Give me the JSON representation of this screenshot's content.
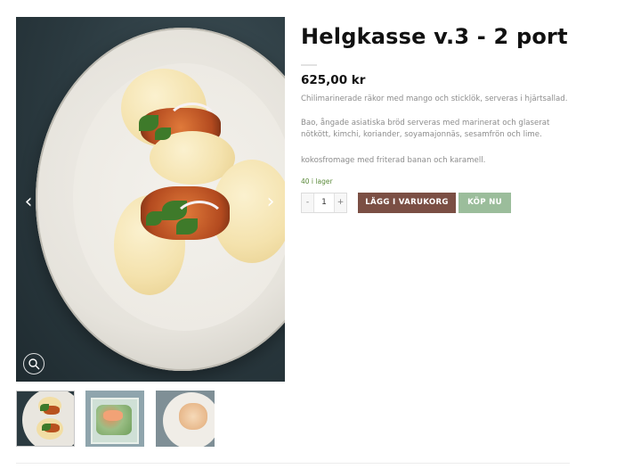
{
  "product": {
    "title": "Helgkasse v.3 - 2 port",
    "price": "625,00 kr",
    "description": [
      "Chilimarinerade räkor med mango och sticklök, serveras i hjärtsallad.",
      "Bao, ångade asiatiska bröd serveras med marinerat och glaserat nötkött, kimchi, koriander, soyamajonnäs, sesamfrön och lime.",
      "kokosfromage med friterad banan och karamell."
    ],
    "stock": "40 i lager"
  },
  "cart": {
    "quantity": "1",
    "minus": "-",
    "plus": "+",
    "add_label": "LÄGG I VARUKORG",
    "buy_label": "KÖP NU"
  },
  "gallery": {
    "prev_arrow": "‹",
    "next_arrow": "›",
    "thumbnails": [
      "thumb-bao",
      "thumb-salad",
      "thumb-dessert"
    ]
  },
  "colors": {
    "add_button": "#7b4f44",
    "buy_button": "#9bbd9b",
    "stock_text": "#5b8a3a"
  }
}
